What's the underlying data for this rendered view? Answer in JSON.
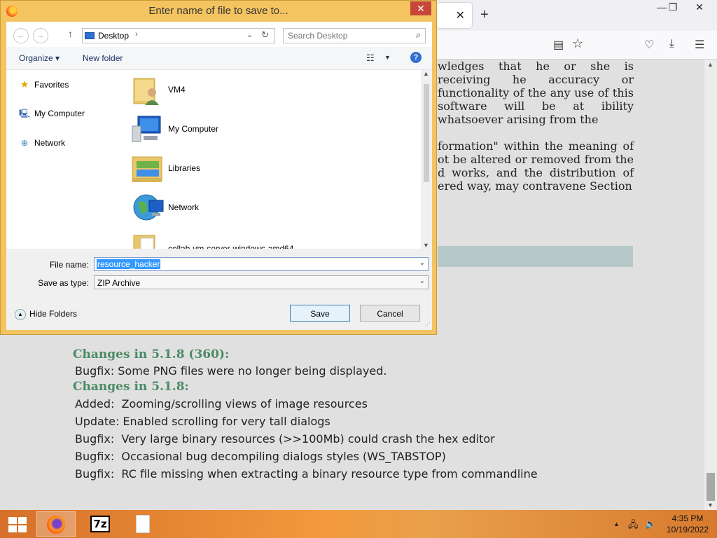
{
  "browser": {
    "tab_close": "✕",
    "new_tab": "+",
    "license_paragraphs": [
      "wledges that he or she is receiving he accuracy or functionality of the any use of this software will be at ibility whatsoever arising from the",
      "formation\" within the meaning of ot be altered or removed from the d works, and the distribution of ered way, may contravene Section"
    ],
    "changes": [
      {
        "heading": "Changes in 5.1.8 (360):",
        "lines": [
          "Bugfix: Some PNG files were no longer being displayed."
        ]
      },
      {
        "heading": "Changes in 5.1.8:",
        "lines": [
          "Added:  Zooming/scrolling views of image resources",
          "Update: Enabled scrolling for very tall dialogs",
          "Bugfix:  Very large binary resources (>>100Mb) could crash the hex editor",
          "Bugfix:  Occasional bug decompiling dialogs styles (WS_TABSTOP)",
          "Bugfix:  RC file missing when extracting a binary resource type from commandline"
        ]
      }
    ]
  },
  "dialog": {
    "title": "Enter name of file to save to...",
    "close": "✕",
    "address": "Desktop",
    "search_placeholder": "Search Desktop",
    "organize": "Organize ▾",
    "new_folder": "New folder",
    "help": "?",
    "nav": [
      "Favorites",
      "My Computer",
      "Network"
    ],
    "files": [
      "VM4",
      "My Computer",
      "Libraries",
      "Network",
      "collab-vm-server-windows-amd64"
    ],
    "file_name_label": "File name:",
    "file_name_value": "resource_hacker",
    "save_type_label": "Save as type:",
    "save_type_value": "ZIP Archive",
    "hide_folders": "Hide Folders",
    "save": "Save",
    "cancel": "Cancel"
  },
  "taskbar": {
    "time": "4:35 PM",
    "date": "10/19/2022",
    "app_7z": "7z"
  }
}
